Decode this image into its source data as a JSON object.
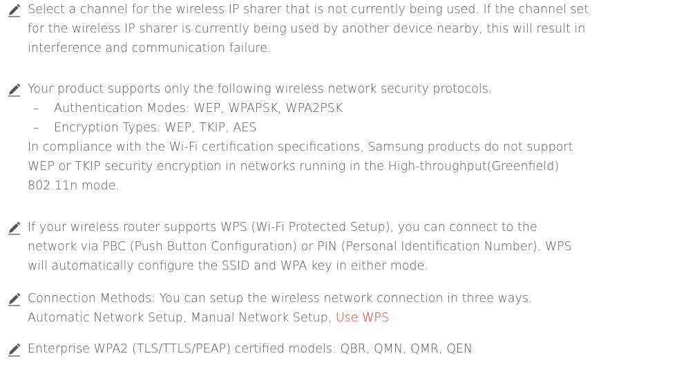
{
  "notes": [
    {
      "icon": "pencil-icon",
      "lines": [
        "Select a channel for the wireless IP sharer that is not currently being used. If the channel set",
        "for the wireless IP sharer is currently being used by another device nearby, this will result in",
        "interference and communication failure."
      ]
    },
    {
      "icon": "pencil-icon",
      "intro": "Your product supports only the following wireless network security protocols.",
      "list_marker": "–",
      "list": [
        "Authentication Modes: WEP, WPAPSK, WPA2PSK",
        "Encryption Types: WEP, TKIP, AES"
      ],
      "lines": [
        "In compliance with the Wi-Fi certification specifications, Samsung products do not support",
        "WEP or TKIP security encryption in networks running in the High-throughput(Greenfield)",
        "802.11n mode."
      ]
    },
    {
      "icon": "pencil-icon",
      "lines": [
        "If your wireless router supports WPS (Wi-Fi Protected Setup), you can connect to the",
        "network via PBC (Push Button Configuration) or PIN (Personal Identification Number). WPS",
        "will automatically configure the SSID and WPA key in either mode."
      ]
    },
    {
      "icon": "pencil-icon",
      "line1": "Connection Methods: You can setup the wireless network connection in three ways.",
      "line2_prefix": "Automatic Network Setup, Manual Network Setup, ",
      "line2_link": "Use WPS"
    },
    {
      "icon": "pencil-icon",
      "line1": "Enterprise WPA2 (TLS/TTLS/PEAP) certified models: QBR, QMN, QMR, QEN"
    }
  ],
  "colors": {
    "text": "#545454",
    "link": "#e0301e",
    "icon": "#555555"
  }
}
